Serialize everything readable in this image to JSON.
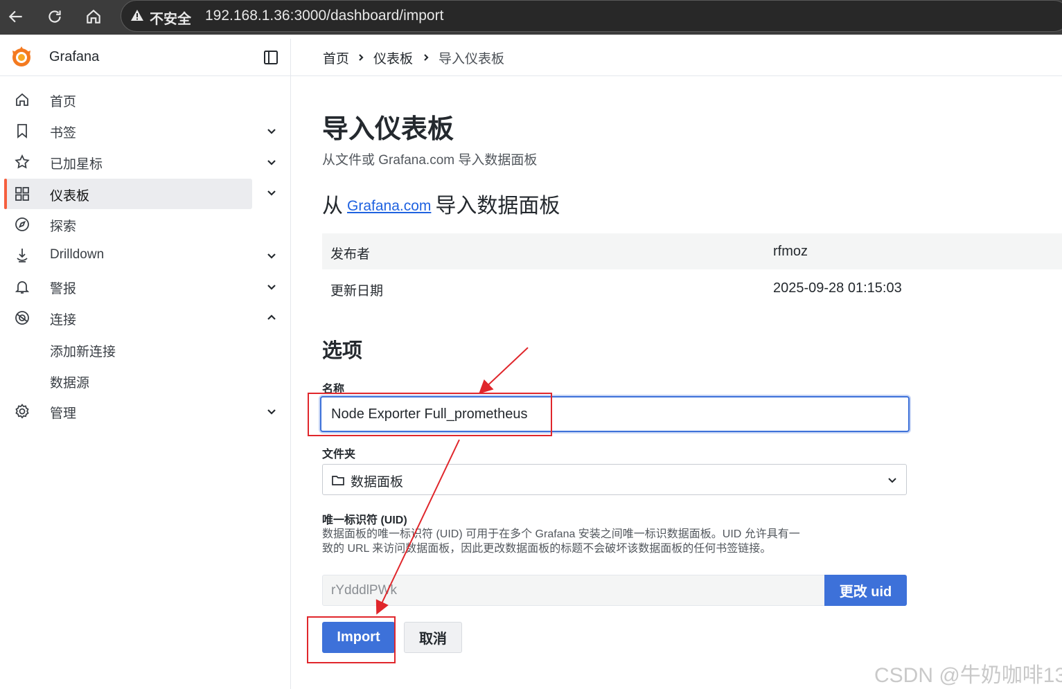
{
  "browser": {
    "security_label": "不安全",
    "url": "192.168.1.36:3000/dashboard/import"
  },
  "sidebar": {
    "brand": "Grafana",
    "items": [
      {
        "label": "首页",
        "icon": "home-icon"
      },
      {
        "label": "书签",
        "icon": "bookmark-icon"
      },
      {
        "label": "已加星标",
        "icon": "star-icon"
      },
      {
        "label": "仪表板",
        "icon": "dashboards-grid-icon"
      },
      {
        "label": "探索",
        "icon": "compass-icon"
      },
      {
        "label": "Drilldown",
        "icon": "drilldown-icon"
      },
      {
        "label": "警报",
        "icon": "bell-icon"
      },
      {
        "label": "连接",
        "icon": "connections-icon"
      },
      {
        "label": "管理",
        "icon": "gear-icon"
      }
    ],
    "connection_subitems": [
      "添加新连接",
      "数据源"
    ]
  },
  "breadcrumb": {
    "items": [
      "首页",
      "仪表板",
      "导入仪表板"
    ]
  },
  "page": {
    "title": "导入仪表板",
    "subtitle": "从文件或 Grafana.com 导入数据面板",
    "section_prefix": "从",
    "section_link": "Grafana.com",
    "section_suffix": "导入数据面板"
  },
  "dashboard_info": {
    "publisher_label": "发布者",
    "publisher_value": "rfmoz",
    "updated_label": "更新日期",
    "updated_value": "2025-09-28 01:15:03"
  },
  "options": {
    "heading": "选项",
    "name_label": "名称",
    "name_value": "Node Exporter Full_prometheus",
    "folder_label": "文件夹",
    "folder_value": "数据面板",
    "uid_label": "唯一标识符 (UID)",
    "uid_description": "数据面板的唯一标识符 (UID) 可用于在多个 Grafana 安装之间唯一标识数据面板。UID 允许具有一致的 URL 来访问数据面板，因此更改数据面板的标题不会破坏该数据面板的任何书签链接。",
    "uid_value": "rYdddlPWk",
    "change_uid_label": "更改 uid"
  },
  "actions": {
    "import_label": "Import",
    "cancel_label": "取消"
  },
  "watermark": "CSDN @牛奶咖啡13",
  "colors": {
    "accent": "#3d71d9",
    "active_bar": "#f55f3e",
    "annotation_red": "#e0262b"
  }
}
